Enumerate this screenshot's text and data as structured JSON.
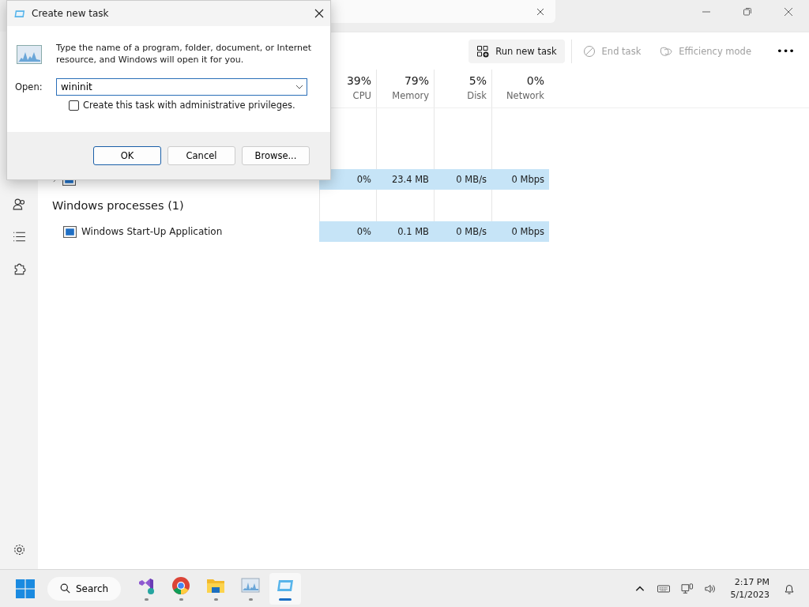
{
  "task_manager": {
    "toolbar": [
      {
        "label": "Run new task",
        "kind": "run",
        "disabled": false
      },
      {
        "label": "End task",
        "kind": "end",
        "disabled": true
      },
      {
        "label": "Efficiency mode",
        "kind": "leaf",
        "disabled": true
      }
    ],
    "more": "•••",
    "columns": [
      {
        "percent": "39%",
        "label": "CPU"
      },
      {
        "percent": "79%",
        "label": "Memory"
      },
      {
        "percent": "5%",
        "label": "Disk"
      },
      {
        "percent": "0%",
        "label": "Network"
      }
    ],
    "rows": [
      {
        "kind": "process",
        "expanded": false,
        "highlight": true,
        "cells": [
          "0%",
          "23.4 MB",
          "0 MB/s",
          "0 Mbps"
        ]
      },
      {
        "kind": "group",
        "name": "Windows processes (1)"
      },
      {
        "kind": "process",
        "name": "Windows Start-Up Application",
        "highlight": true,
        "cells": [
          "0%",
          "0.1 MB",
          "0 MB/s",
          "0 Mbps"
        ]
      }
    ]
  },
  "dialog": {
    "title": "Create new task",
    "message": "Type the name of a program, folder, document, or Internet resource, and Windows will open it for you.",
    "open_label": "Open:",
    "open_value": "wininit",
    "admin_checkbox": {
      "label": "Create this task with administrative privileges.",
      "checked": false
    },
    "buttons": [
      {
        "label": "OK",
        "default": true
      },
      {
        "label": "Cancel",
        "default": false
      },
      {
        "label": "Browse...",
        "default": false
      }
    ]
  },
  "taskbar": {
    "search": "Search",
    "apps": [
      {
        "kind": "vs",
        "active": false
      },
      {
        "kind": "chrome",
        "active": false
      },
      {
        "kind": "folder",
        "active": false
      },
      {
        "kind": "monitor",
        "active": false
      },
      {
        "kind": "taskmgr",
        "active": true
      }
    ],
    "time": "2:17 PM",
    "date": "5/1/2023"
  }
}
